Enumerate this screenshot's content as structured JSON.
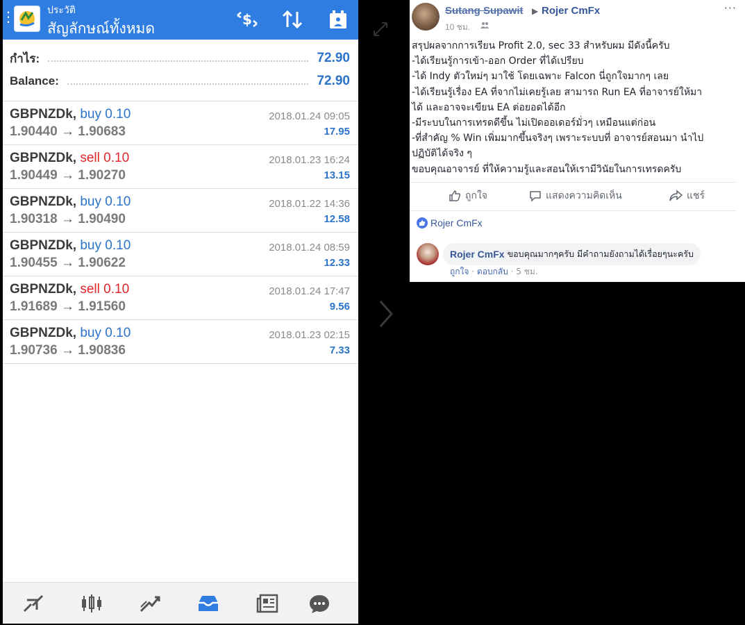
{
  "mt4": {
    "header": {
      "subtitle": "ประวัติ",
      "title": "สัญลักษณ์ทั้งหมด"
    },
    "summary": {
      "profit_label": "กำไร:",
      "profit_value": "72.90",
      "balance_label": "Balance:",
      "balance_value": "72.90"
    },
    "trades": [
      {
        "symbol": "GBPNZDk,",
        "side": "buy",
        "volume": "0.10",
        "open": "1.90440",
        "close": "1.90683",
        "time": "2018.01.24 09:05",
        "profit": "17.95"
      },
      {
        "symbol": "GBPNZDk,",
        "side": "sell",
        "volume": "0.10",
        "open": "1.90449",
        "close": "1.90270",
        "time": "2018.01.23 16:24",
        "profit": "13.15"
      },
      {
        "symbol": "GBPNZDk,",
        "side": "buy",
        "volume": "0.10",
        "open": "1.90318",
        "close": "1.90490",
        "time": "2018.01.22 14:36",
        "profit": "12.58"
      },
      {
        "symbol": "GBPNZDk,",
        "side": "buy",
        "volume": "0.10",
        "open": "1.90455",
        "close": "1.90622",
        "time": "2018.01.24 08:59",
        "profit": "12.33"
      },
      {
        "symbol": "GBPNZDk,",
        "side": "sell",
        "volume": "0.10",
        "open": "1.91689",
        "close": "1.91560",
        "time": "2018.01.24 17:47",
        "profit": "9.56"
      },
      {
        "symbol": "GBPNZDk,",
        "side": "buy",
        "volume": "0.10",
        "open": "1.90736",
        "close": "1.90836",
        "time": "2018.01.23 02:15",
        "profit": "7.33"
      }
    ],
    "arrow_glyph": "→",
    "bottom_nav": [
      "quotes-icon",
      "chart-icon",
      "trade-icon",
      "history-icon",
      "news-icon",
      "chat-icon"
    ],
    "colors": {
      "header": "#2f7de0",
      "buy": "#2a73c9",
      "sell": "#e0262c"
    }
  },
  "fb": {
    "author": "Sutang Supawit",
    "target": "Rojer CmFx",
    "time": "10 ชม.",
    "more": "···",
    "post_lines": [
      "สรุปผลจากการเรียน Profit 2.0, sec 33 สำหรับผม มีดังนี้ครับ",
      "-ได้เรียนรู้การเข้า-ออก Order ที่ได้เปรียบ",
      "-ได้ Indy ตัวใหม่ๆ มาใช้ โดยเฉพาะ Falcon นี่ถูกใจมากๆ เลย",
      "-ได้เรียนรู้เรื่อง EA ที่จากไม่เคยรู้เลย สามารถ Run EA ที่อาจารย์ให้มา",
      "ได้ และอาจจะเขียน EA ต่อยอดได้อีก",
      "-มีระบบในการเทรดดีขึ้น ไม่เปิดออเดอร์มั่วๆ เหมือนแต่ก่อน",
      "-ที่สำคัญ % Win เพิ่มมากขึ้นจริงๆ เพราะระบบที่ อาจารย์สอนมา นำไป",
      "ปฏิบัติได้จริง ๆ",
      "ขอบคุณอาจารย์ ที่ให้ความรู้และสอนให้เรามีวินัยในการเทรดครับ"
    ],
    "actions": {
      "like": "ถูกใจ",
      "comment": "แสดงความคิดเห็น",
      "share": "แชร์"
    },
    "likes_by": "Rojer CmFx",
    "comment": {
      "name": "Rojer CmFx",
      "text": "ขอบคุณมากๆครับ มีคำถามยังถามได้เรื่อยๆนะครับ",
      "like": "ถูกใจ",
      "sep": "·",
      "reply": "ตอบกลับ",
      "time": "5 ชม."
    },
    "colors": {
      "link": "#365899"
    }
  }
}
